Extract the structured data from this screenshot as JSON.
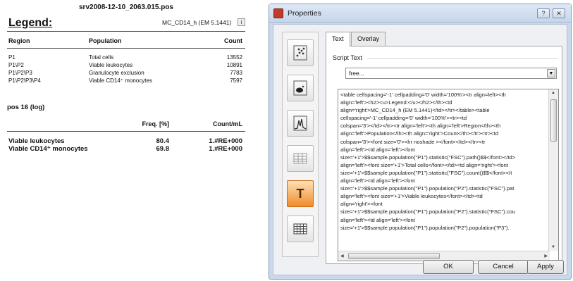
{
  "report": {
    "file_name": "srv2008-12-10_2063.015.pos",
    "legend_title": "Legend:",
    "sample_name": "MC_CD14_h (EM 5.1441)",
    "info_glyph": "i",
    "table_headers": {
      "region": "Region",
      "population": "Population",
      "count": "Count"
    },
    "rows": [
      {
        "region": "P1",
        "population": "Total cells",
        "count": "13552"
      },
      {
        "region": "P1\\P2",
        "population": "Viable leukocytes",
        "count": "10891"
      },
      {
        "region": "P1\\P2\\P3",
        "population": "Granulocyte exclusion",
        "count": "7783"
      },
      {
        "region": "P1\\P2\\P3\\P4",
        "population": "Viable CD14⁺ monocytes",
        "count": "7597"
      }
    ],
    "pos_title": "pos 16 (log)",
    "stat_headers": {
      "freq": "Freq. [%]",
      "count_ml": "Count/mL"
    },
    "stat_rows": [
      {
        "name": "Viable leukocytes",
        "freq": "80.4",
        "count_ml": "1.#RE+000"
      },
      {
        "name": "Viable CD14⁺ monocytes",
        "freq": "69.8",
        "count_ml": "1.#RE+000"
      }
    ]
  },
  "dialog": {
    "title": "Properties",
    "help_glyph": "?",
    "close_glyph": "✕",
    "tabs": [
      "Text",
      "Overlay"
    ],
    "group_label": "Script Text",
    "selected_script": "free...",
    "dropdown_glyph": "▼",
    "script_text": "<table cellspacing='-1' cellpadding='0' width='100%'><tr align=left><th\nalign='left'><h2><u>Legend:</u></h2></th><td\nalign='right'>MC_CD14_h (EM 5.1441)</td></tr></table><table\ncellspacing='-1' cellpadding='0' width='100%'><tr><td\ncolspan='3'></td></tr><tr align='left'><th align='left'>Region</th><th\nalign='left'>Population</th><th align='right'>Count</th></tr><tr><td\ncolspan='3'><font size='0'><hr noshade ></font></td></tr><tr\nalign='left'><td align='left'><font\nsize='+1'>$$sample.population(\"P1\").statistic(\"FSC\").path()$$</font></td>\nalign='left'><font size='+1'>Total cells</font></td><td align='right'><font\nsize='+1'>$$sample.population(\"P1\").statistic(\"FSC\").count()$$</font></t\nalign='left'><td align='left'><font\nsize='+1'>$$sample.population(\"P1\").population(\"P2\").statistic(\"FSC\").pat\nalign='left'><font size='+1'>Viable leukocytes</font></td><td\nalign='right'><font\nsize='+1'>$$sample.population(\"P1\").population(\"P2\").statistic(\"FSC\").cou\nalign='left'><td align='left'><font\nsize='+1'>$$sample.population(\"P1\").population(\"P2\").population(\"P3\").",
    "buttons": {
      "ok": "OK",
      "cancel": "Cancel",
      "apply": "Apply"
    },
    "sidebar_icons": [
      "scatter-plot-icon",
      "dot-plot-icon",
      "histogram-icon",
      "statistics-table-icon",
      "text-icon",
      "grid-table-icon"
    ],
    "text_tool_glyph": "T"
  },
  "colors": {
    "dialog_background": "#c9d8ec",
    "active_tool": "#f08a2a",
    "app_icon": "#c23a2a"
  }
}
